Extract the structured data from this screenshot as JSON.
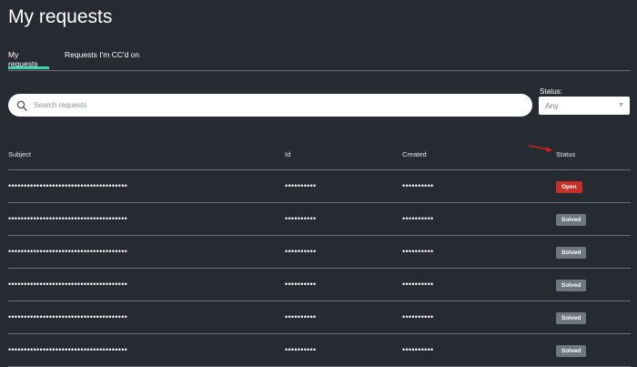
{
  "page": {
    "title": "My requests"
  },
  "tabs": [
    {
      "label": "My requests",
      "active": true
    },
    {
      "label": "Requests I'm CC'd on",
      "active": false
    }
  ],
  "search": {
    "placeholder": "Search requests",
    "value": ""
  },
  "status_filter": {
    "label": "Status:",
    "value": "Any"
  },
  "table": {
    "headers": {
      "subject": "Subject",
      "id": "Id",
      "created": "Created",
      "status": "Status"
    },
    "rows": [
      {
        "subject": "••••••••••••••••••••••••••••••••••••••",
        "id": "••••••••••",
        "created": "••••••••••",
        "status": "Open"
      },
      {
        "subject": "••••••••••••••••••••••••••••••••••••••",
        "id": "••••••••••",
        "created": "••••••••••",
        "status": "Solved"
      },
      {
        "subject": "••••••••••••••••••••••••••••••••••••••",
        "id": "••••••••••",
        "created": "••••••••••",
        "status": "Solved"
      },
      {
        "subject": "••••••••••••••••••••••••••••••••••••••",
        "id": "••••••••••",
        "created": "••••••••••",
        "status": "Solved"
      },
      {
        "subject": "••••••••••••••••••••••••••••••••••••••",
        "id": "••••••••••",
        "created": "••••••••••",
        "status": "Solved"
      },
      {
        "subject": "••••••••••••••••••••••••••••••••••••••",
        "id": "••••••••••",
        "created": "••••••••••",
        "status": "Solved"
      }
    ]
  },
  "colors": {
    "background": "#262b31",
    "tab_accent": "#3fd6b0",
    "open_badge": "#c62f2a",
    "solved_badge": "#6f7880",
    "annotation_arrow": "#d6201e"
  },
  "icons": {
    "search": "search-icon",
    "select": "chevron-down-icon",
    "annotation": "red-arrow-icon"
  }
}
